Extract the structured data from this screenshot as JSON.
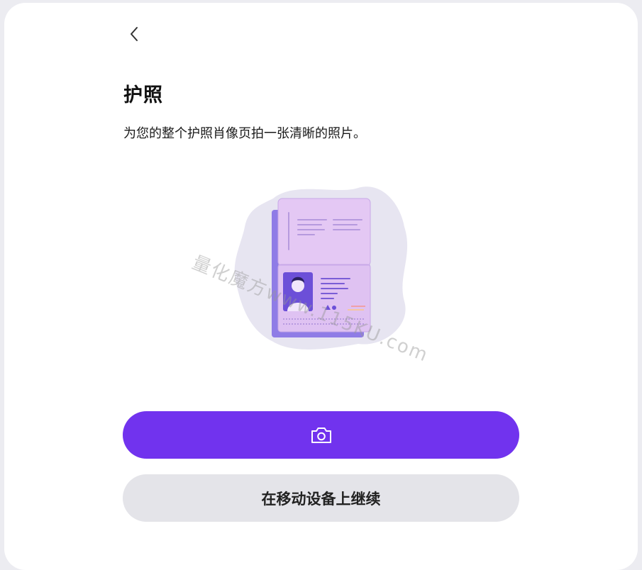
{
  "header": {
    "back_icon": "chevron-left-icon"
  },
  "page": {
    "title": "护照",
    "subtitle": "为您的整个护照肖像页拍一张清晰的照片。"
  },
  "illustration": {
    "name": "passport-illustration"
  },
  "watermark": {
    "text": "量化魔方www.115KU.com"
  },
  "actions": {
    "camera_icon": "camera-icon",
    "primary_color": "#7133ee",
    "secondary_label": "在移动设备上继续",
    "secondary_color": "#e4e4e9"
  }
}
